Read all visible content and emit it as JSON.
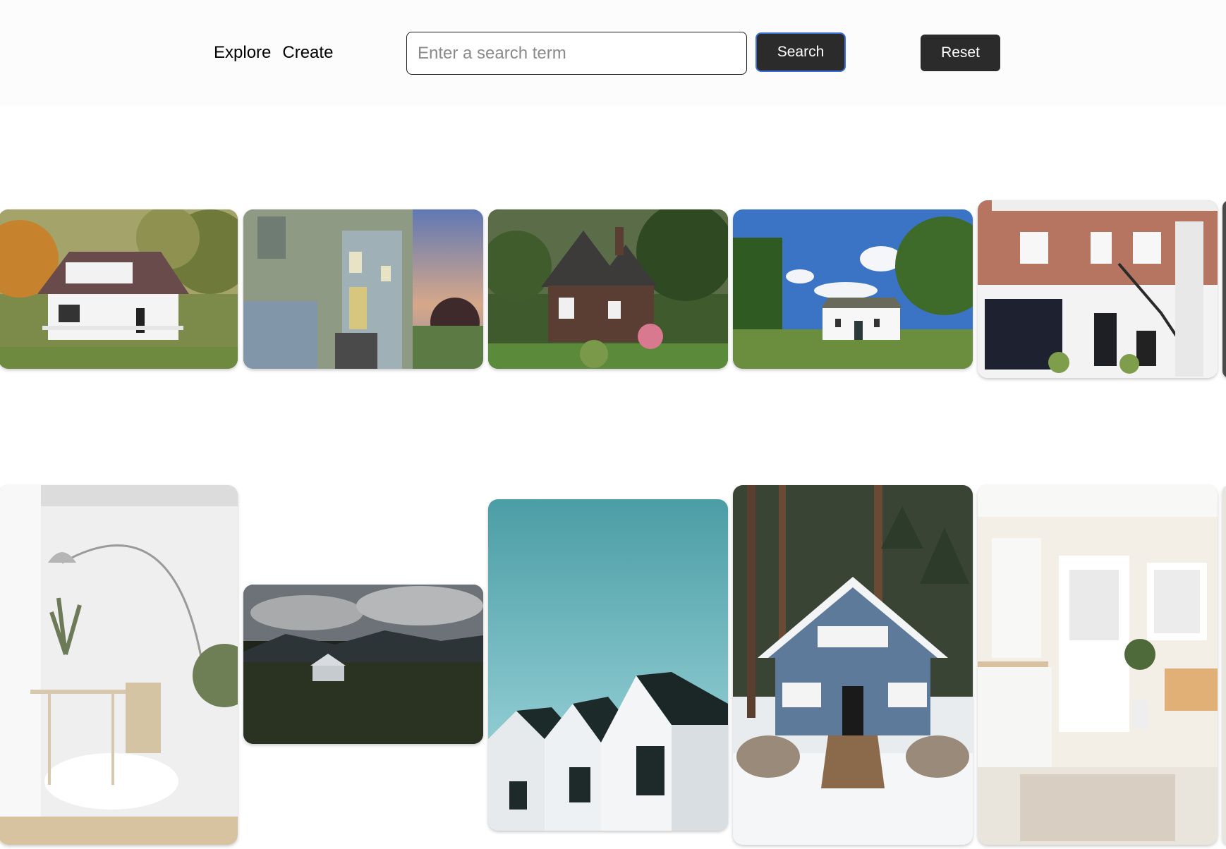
{
  "nav": {
    "explore": "Explore",
    "create": "Create"
  },
  "search": {
    "placeholder": "Enter a search term",
    "value": ""
  },
  "buttons": {
    "search": "Search",
    "reset": "Reset"
  },
  "gallery": {
    "images": [
      "white-bungalow-autumn",
      "modern-house-dusk",
      "brick-cottage-garden",
      "white-farmhouse-blue-sky",
      "brick-townhouse-balcony",
      "white-interior-arc-lamp",
      "lone-house-storm",
      "gabled-houses-teal-sky",
      "blue-cabin-snow-forest",
      "white-kitchen-door"
    ]
  }
}
